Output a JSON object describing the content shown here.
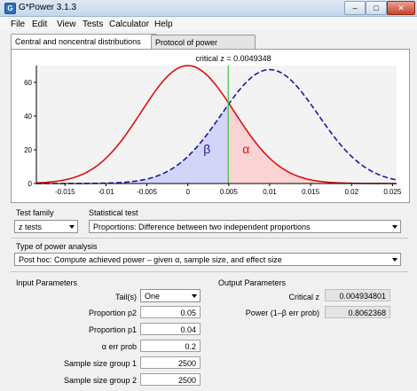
{
  "window": {
    "title": "G*Power 3.1.3",
    "controls": {
      "minimize": "–",
      "maximize": "□",
      "close": "✕"
    }
  },
  "menu": [
    "File",
    "Edit",
    "View",
    "Tests",
    "Calculator",
    "Help"
  ],
  "tabs": [
    "Central and noncentral distributions",
    "Protocol of power analyses"
  ],
  "plot": {
    "critical_label": "critical z = 0.0049348",
    "critical_z": 0.0049348,
    "beta_label": "β",
    "alpha_label": "α",
    "x_ticks": [
      "-0.015",
      "-0.01",
      "-0.005",
      "0",
      "0.005",
      "0.01",
      "0.015",
      "0.02",
      "0.025"
    ],
    "y_ticks": [
      "0",
      "20",
      "40",
      "60"
    ],
    "colors": {
      "h0": "#e01010",
      "h1": "#1a1aa0",
      "critical": "#3cc33c",
      "beta_fill": "#d4d4f8",
      "alpha_fill": "#fad4d4"
    }
  },
  "chart_data": {
    "type": "line",
    "xlim": [
      -0.0185,
      0.0255
    ],
    "ylim": [
      0,
      70
    ],
    "series": [
      {
        "distribution": "normal",
        "mean": 0,
        "sd": 0.0057,
        "style": "solid",
        "color": "#e01010"
      },
      {
        "distribution": "normal",
        "mean": 0.01,
        "sd": 0.0059,
        "style": "dashed",
        "color": "#1a1aa0"
      }
    ],
    "critical_x": 0.0049348,
    "shaded": {
      "beta": "x < critical_x under H1 curve",
      "alpha": "x > critical_x under H0 curve"
    },
    "grid": false,
    "legend": "none"
  },
  "test_family": {
    "label": "Test family",
    "value": "z tests"
  },
  "statistical_test": {
    "label": "Statistical test",
    "value": "Proportions: Difference between two independent proportions"
  },
  "power_analysis": {
    "label": "Type of power analysis",
    "value": "Post hoc: Compute achieved power – given α, sample size, and effect size"
  },
  "input": {
    "title": "Input Parameters",
    "tails": {
      "label": "Tail(s)",
      "value": "One"
    },
    "fields": [
      {
        "label": "Proportion p2",
        "value": "0.05"
      },
      {
        "label": "Proportion p1",
        "value": "0.04"
      },
      {
        "label": "α err prob",
        "value": "0.2"
      },
      {
        "label": "Sample size group 1",
        "value": "2500"
      },
      {
        "label": "Sample size group 2",
        "value": "2500"
      }
    ]
  },
  "output": {
    "title": "Output Parameters",
    "fields": [
      {
        "label": "Critical z",
        "value": "0.004934801"
      },
      {
        "label": "Power (1–β err prob)",
        "value": "0.8062368"
      }
    ]
  }
}
